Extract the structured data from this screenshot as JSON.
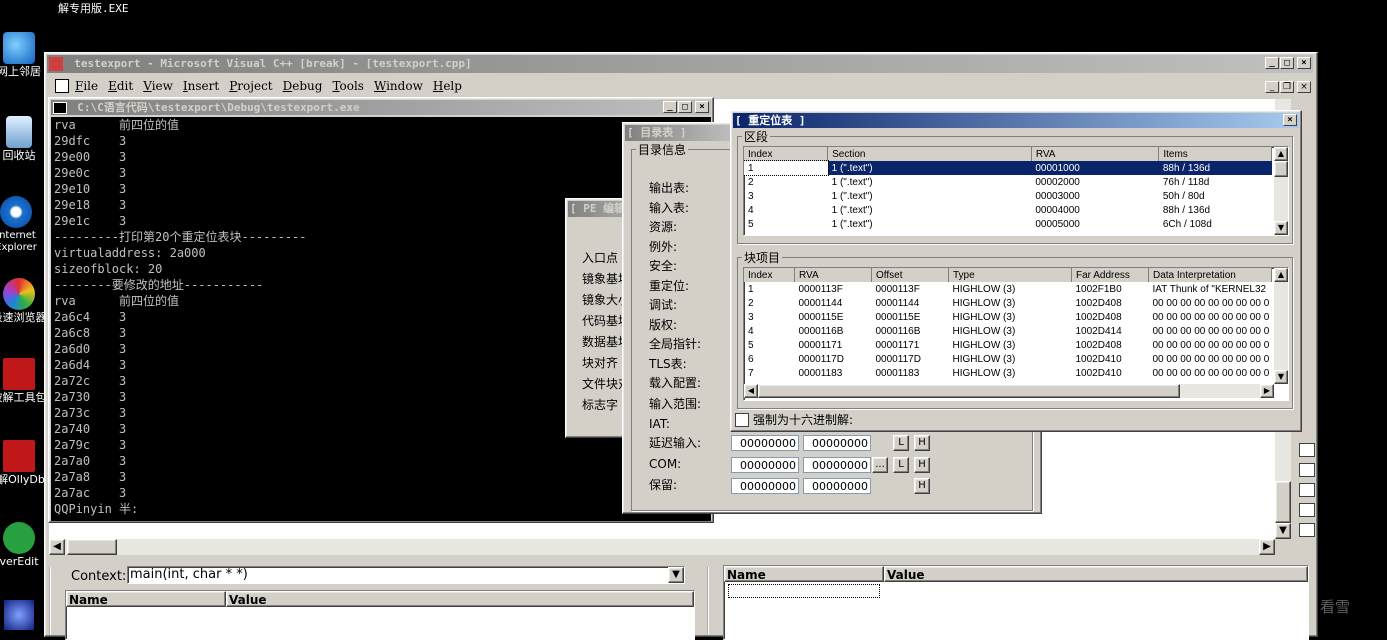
{
  "desktop": {
    "top_label": "解专用版.EXE",
    "icons": [
      {
        "label": "网上邻居"
      },
      {
        "label": "回收站"
      },
      {
        "label": "Internet Explorer"
      },
      {
        "label": "极速浏览器"
      },
      {
        "label": "破解工具包"
      },
      {
        "label": "破解OllyDbg"
      },
      {
        "label": "verEdit"
      }
    ],
    "watermark": "看雪"
  },
  "vc": {
    "title": "testexport - Microsoft Visual C++ [break] - [testexport.cpp]",
    "menu": [
      "File",
      "Edit",
      "View",
      "Insert",
      "Project",
      "Debug",
      "Tools",
      "Window",
      "Help"
    ],
    "context_label": "Context:",
    "context_value": "main(int, char * *)",
    "vars_headers": [
      "Name",
      "Value"
    ],
    "watch_headers": [
      "Name",
      "Value"
    ]
  },
  "console": {
    "title": "C:\\C语言代码\\testexport\\Debug\\testexport.exe",
    "lines": [
      "rva      前四位的值",
      "29dfc    3",
      "29e00    3",
      "29e0c    3",
      "29e10    3",
      "29e18    3",
      "29e1c    3",
      "---------打印第20个重定位表块---------",
      "virtualaddress: 2a000",
      "sizeofblock: 20",
      "--------要修改的地址-----------",
      "rva      前四位的值",
      "2a6c4    3",
      "2a6c8    3",
      "2a6d0    3",
      "2a6d4    3",
      "2a72c    3",
      "2a730    3",
      "2a73c    3",
      "2a740    3",
      "2a79c    3",
      "2a7a0    3",
      "2a7a8    3",
      "2a7ac    3",
      "QQPinyin 半:"
    ]
  },
  "pe_editor": {
    "title": "[ PE 编辑",
    "labels": [
      "入口点",
      "镜象基址",
      "镜象大小",
      "代码基址",
      "数据基址",
      "块对齐",
      "文件块对齐",
      "标志字"
    ]
  },
  "dir_table": {
    "title": "[ 目录表 ]",
    "group": "目录信息",
    "labels": [
      "输出表:",
      "输入表:",
      "资源:",
      "例外:",
      "安全:",
      "重定位:",
      "调试:",
      "版权:",
      "全局指针:",
      "TLS表:",
      "载入配置:",
      "输入范围:",
      "IAT:",
      "延迟输入:",
      "COM:",
      "保留:"
    ],
    "rows": [
      {
        "rva": "00000000",
        "size": "00000000",
        "buttons": [
          "L",
          "H"
        ]
      },
      {
        "rva": "00000000",
        "size": "00000000",
        "buttons": [
          "...",
          "L",
          "H"
        ]
      },
      {
        "rva": "00000000",
        "size": "00000000",
        "buttons": [
          "H"
        ]
      }
    ]
  },
  "reloc": {
    "title": "[ 重定位表 ]",
    "section_group": "区段",
    "section_headers": [
      "Index",
      "Section",
      "RVA",
      "Items"
    ],
    "sections": [
      [
        "1",
        "1 (\".text\")",
        "00001000",
        "88h / 136d"
      ],
      [
        "2",
        "1 (\".text\")",
        "00002000",
        "76h / 118d"
      ],
      [
        "3",
        "1 (\".text\")",
        "00003000",
        "50h / 80d"
      ],
      [
        "4",
        "1 (\".text\")",
        "00004000",
        "88h / 136d"
      ],
      [
        "5",
        "1 (\".text\")",
        "00005000",
        "6Ch / 108d"
      ]
    ],
    "block_group": "块项目",
    "block_headers": [
      "Index",
      "RVA",
      "Offset",
      "Type",
      "Far Address",
      "Data Interpretation"
    ],
    "blocks": [
      [
        "1",
        "0000113F",
        "0000113F",
        "HIGHLOW (3)",
        "1002F1B0",
        "IAT Thunk of \"KERNEL32"
      ],
      [
        "2",
        "00001144",
        "00001144",
        "HIGHLOW (3)",
        "1002D408",
        "00 00 00 00 00 00 00 00 0"
      ],
      [
        "3",
        "0000115E",
        "0000115E",
        "HIGHLOW (3)",
        "1002D408",
        "00 00 00 00 00 00 00 00 0"
      ],
      [
        "4",
        "0000116B",
        "0000116B",
        "HIGHLOW (3)",
        "1002D414",
        "00 00 00 00 00 00 00 00 0"
      ],
      [
        "5",
        "00001171",
        "00001171",
        "HIGHLOW (3)",
        "1002D408",
        "00 00 00 00 00 00 00 00 0"
      ],
      [
        "6",
        "0000117D",
        "0000117D",
        "HIGHLOW (3)",
        "1002D410",
        "00 00 00 00 00 00 00 00 0"
      ],
      [
        "7",
        "00001183",
        "00001183",
        "HIGHLOW (3)",
        "1002D410",
        "00 00 00 00 00 00 00 00 0"
      ]
    ],
    "force_hex_label": "强制为十六进制解:"
  }
}
